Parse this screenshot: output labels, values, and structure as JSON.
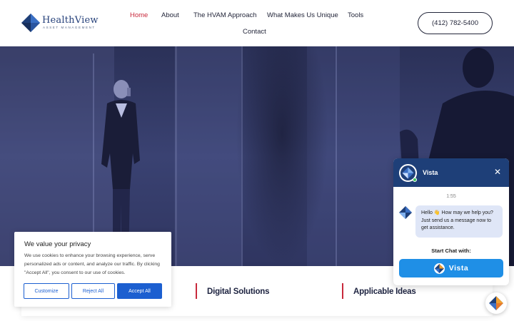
{
  "header": {
    "logo": {
      "brand": "HealthView",
      "sub": "ASSET MANAGEMENT"
    },
    "nav": [
      {
        "label": "Home",
        "active": true
      },
      {
        "label": "About",
        "active": false
      },
      {
        "label": "The HVAM Approach",
        "active": false
      },
      {
        "label": "What Makes Us Unique",
        "active": false
      },
      {
        "label": "Tools",
        "active": false
      },
      {
        "label": "Contact",
        "active": false
      }
    ],
    "phone": "(412) 782-5400"
  },
  "solutions": [
    {
      "label": "Digital Solutions"
    },
    {
      "label": "Applicable Ideas"
    }
  ],
  "cookie": {
    "title": "We value your privacy",
    "text": "We use cookies to enhance your browsing experience, serve personalized ads or content, and analyze our traffic. By clicking \"Accept All\", you consent to our use of cookies.",
    "customize": "Customize",
    "reject": "Reject All",
    "accept": "Accept All"
  },
  "chat": {
    "name": "Vista",
    "close_icon": "close-icon",
    "time": "1:55",
    "message": "Hello 👋 How may we help you? Just send us a message now to get assistance.",
    "start_label": "Start Chat with:",
    "vista_button": "Vista",
    "online_color": "#3cc35f"
  },
  "colors": {
    "brand_navy": "#25407a",
    "accent_red": "#c8293c",
    "chat_header": "#1e3f78",
    "chat_button": "#1f8fe6",
    "cookie_blue": "#1c5fd0"
  }
}
